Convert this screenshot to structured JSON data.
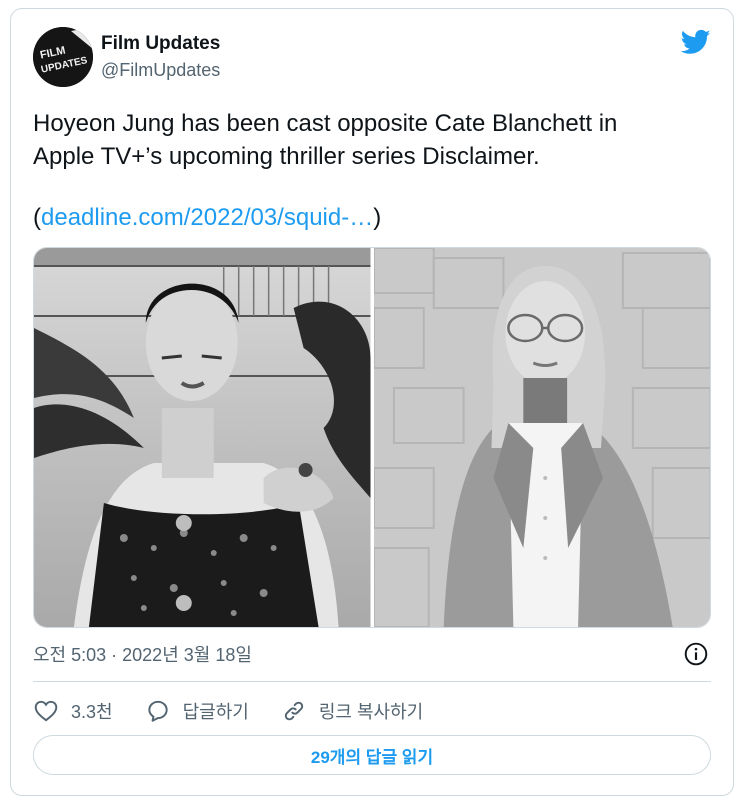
{
  "author": {
    "name": "Film Updates",
    "handle": "@FilmUpdates",
    "avatar_text": "FILM UPDATES"
  },
  "tweet": {
    "text_line1": "Hoyeon Jung has been cast opposite Cate Blanchett in",
    "text_line2": "Apple TV+’s upcoming thriller series Disclaimer.",
    "link_open": "(",
    "link_text": "deadline.com/2022/03/squid-…",
    "link_close": ")"
  },
  "meta": {
    "timestamp": "오전 5:03 · 2022년 3월 18일"
  },
  "actions": {
    "like_count": "3.3천",
    "reply_label": "답글하기",
    "copy_link_label": "링크 복사하기"
  },
  "cta_label": "29개의 답글 읽기",
  "icons": {
    "brand": "twitter-bird-icon",
    "info": "info-icon",
    "like": "heart-icon",
    "reply": "speech-bubble-icon",
    "copy": "link-chain-icon"
  },
  "colors": {
    "accent": "#1d9bf0",
    "text": "#0f1419",
    "muted": "#536471",
    "border": "#cfd9de"
  }
}
